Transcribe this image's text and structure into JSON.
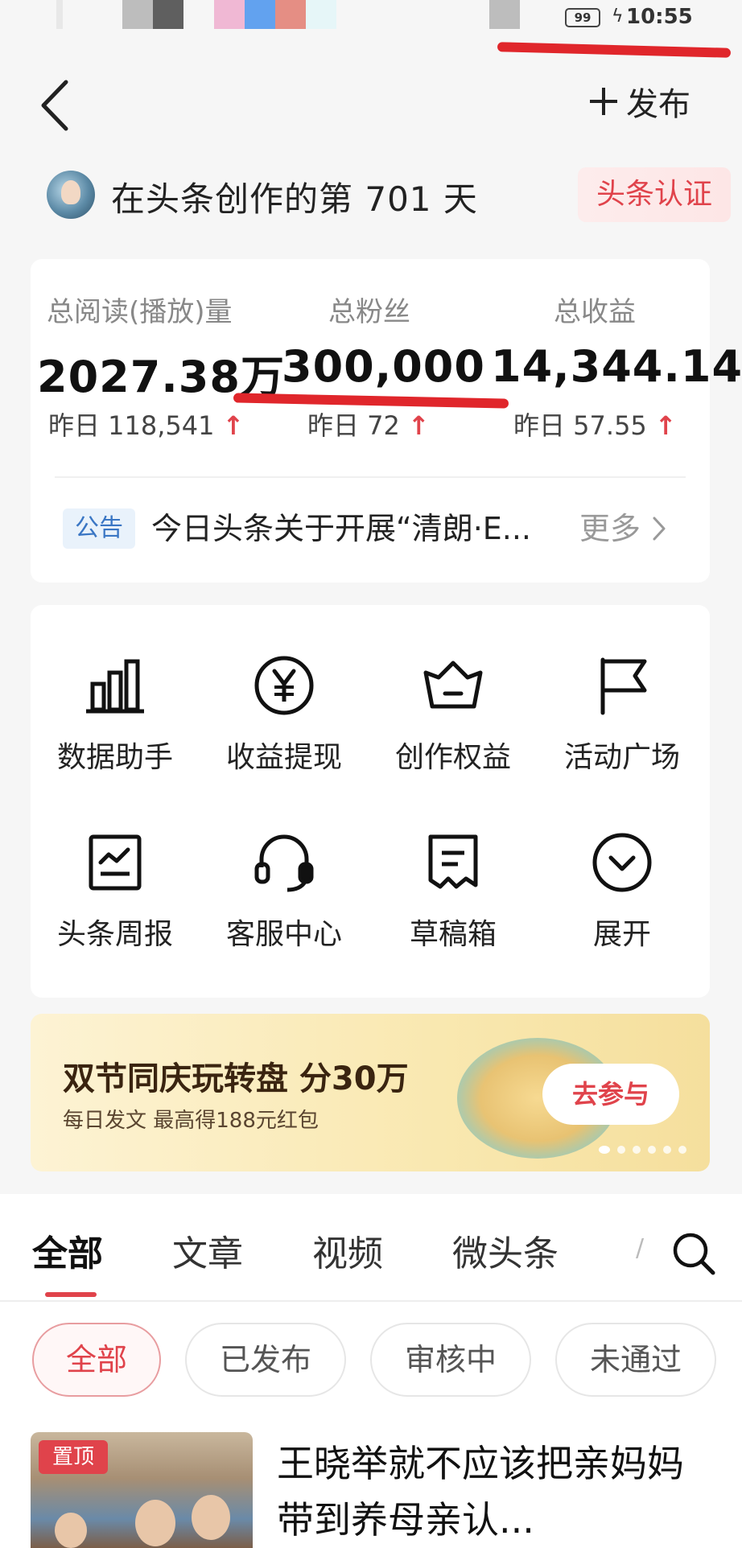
{
  "status_bar": {
    "battery": "99",
    "time": "10:55",
    "charging_icon": "lightning-icon"
  },
  "header": {
    "back_icon": "chevron-left-icon",
    "publish_label": "发布",
    "publish_icon": "plus-icon"
  },
  "creator": {
    "text": "在头条创作的第 701 天",
    "badge": "头条认证"
  },
  "stats": [
    {
      "label": "总阅读(播放)量",
      "value": "2027.38万",
      "yesterday": "昨日 118,541",
      "trend": "↑"
    },
    {
      "label": "总粉丝",
      "value": "300,000",
      "yesterday": "昨日 72",
      "trend": "↑"
    },
    {
      "label": "总收益",
      "value": "14,344.14",
      "yesterday": "昨日 57.55",
      "trend": "↑"
    }
  ],
  "notice": {
    "tag": "公告",
    "text": "今日头条关于开展“清朗·E...",
    "more": "更多"
  },
  "tools": [
    {
      "label": "数据助手",
      "icon": "bar-chart-icon"
    },
    {
      "label": "收益提现",
      "icon": "yuan-coin-icon"
    },
    {
      "label": "创作权益",
      "icon": "crown-icon"
    },
    {
      "label": "活动广场",
      "icon": "flag-icon"
    },
    {
      "label": "头条周报",
      "icon": "report-icon"
    },
    {
      "label": "客服中心",
      "icon": "headset-icon"
    },
    {
      "label": "草稿箱",
      "icon": "draft-icon"
    },
    {
      "label": "展开",
      "icon": "expand-circle-icon"
    }
  ],
  "banner": {
    "title": "双节同庆玩转盘 分30万",
    "subtitle": "每日发文 最高得188元红包",
    "button": "去参与",
    "page_count": 6,
    "active_page": 1
  },
  "tabs": [
    "全部",
    "文章",
    "视频",
    "微头条"
  ],
  "tab_overflow": "/",
  "search_icon": "search-icon",
  "filters": [
    "全部",
    "已发布",
    "审核中",
    "未通过"
  ],
  "article": {
    "badge": "置顶",
    "title": "王晓举就不应该把亲妈妈带到养母亲认..."
  },
  "colors": {
    "accent": "#e0434b",
    "notice_blue": "#3a76c4",
    "annotation_red": "#e0262b"
  }
}
